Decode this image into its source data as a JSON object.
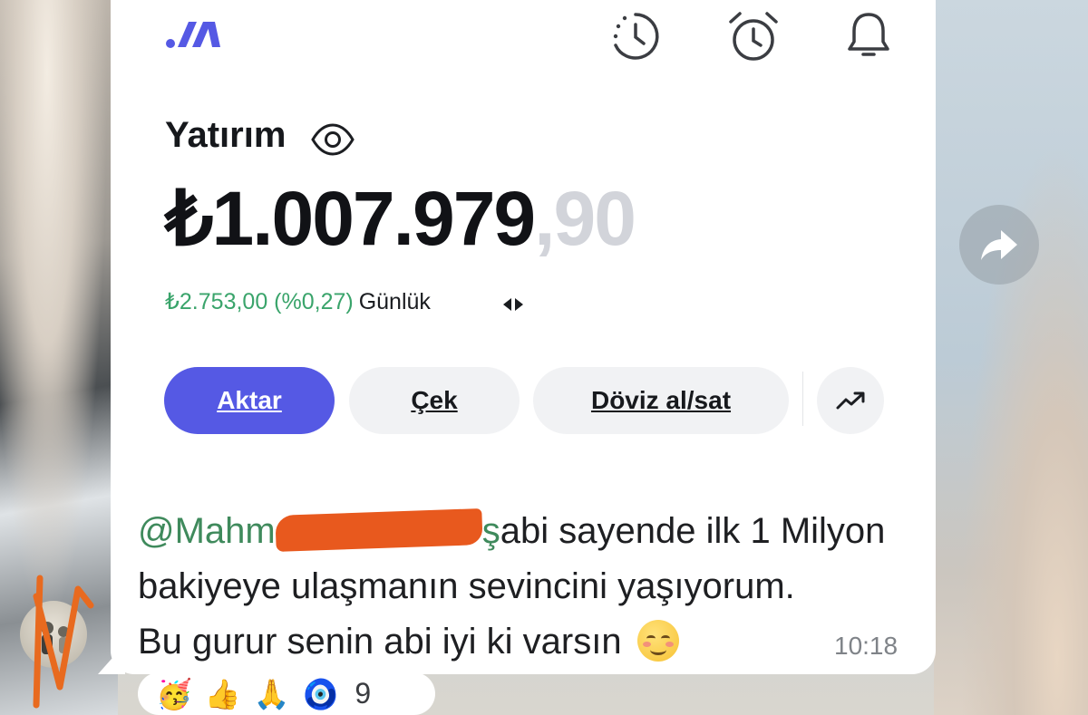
{
  "portfolio": {
    "title": "Yatırım",
    "amount_main": "₺1.007.979",
    "amount_cents": ",90",
    "daily_change": "₺2.753,00 (%0,27)",
    "daily_period": "Günlük"
  },
  "actions": {
    "transfer": "Aktar",
    "withdraw": "Çek",
    "fx": "Döviz al/sat"
  },
  "message": {
    "mention_start": "@Mahm",
    "mention_end": "ş",
    "text_line1": "abi sayende ilk 1 Milyon",
    "text_line2": "bakiyeye ulaşmanın sevincini yaşıyorum.",
    "text_line3": "Bu gurur senin abi iyi ki varsın",
    "time": "10:18"
  },
  "reactions": {
    "items": [
      "🥳",
      "👍",
      "🙏",
      "🧿"
    ],
    "count": "9"
  },
  "colors": {
    "accent": "#5559e4",
    "positive": "#3aa46b",
    "mention": "#3f8a5c",
    "redaction": "#e8591e"
  },
  "icons": [
    "app-logo-icon",
    "history-icon",
    "alarm-icon",
    "bell-icon",
    "eye-icon",
    "swap-arrows-icon",
    "trend-up-icon",
    "forward-icon"
  ]
}
